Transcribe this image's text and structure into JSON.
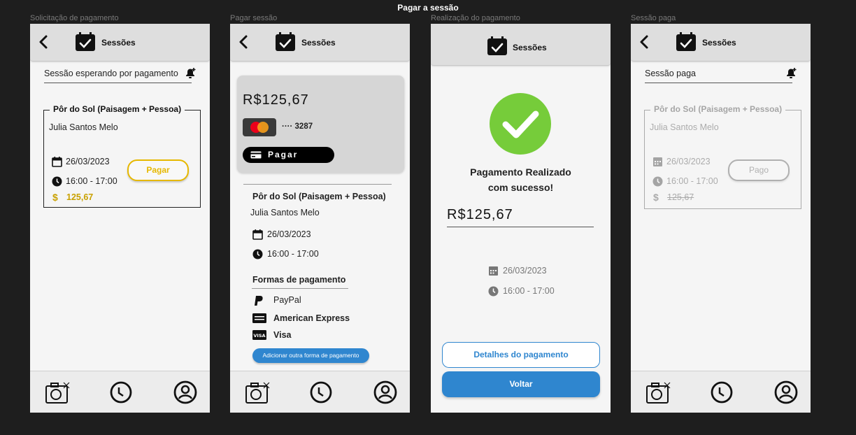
{
  "canvas_title": "Pagar a sessão",
  "frames": [
    {
      "label": "Solicitação de pagamento"
    },
    {
      "label": "Pagar sessão"
    },
    {
      "label": "Realização do pagamento"
    },
    {
      "label": "Sessão paga"
    }
  ],
  "topbar_title": "Sessões",
  "screen1": {
    "heading": "Sessão esperando por pagamento",
    "session_title": "Pôr do Sol (Paisagem + Pessoa)",
    "client": "Julia Santos Melo",
    "date": "26/03/2023",
    "time": "16:00 - 17:00",
    "currency_symbol": "$",
    "price": "125,67",
    "pay_button": "Pagar",
    "accent": "#e6b800"
  },
  "screen2": {
    "amount": "R$125,67",
    "card_dots": "····",
    "card_last4": "3287",
    "pay_button": "Pagar",
    "session_title": "Pôr do Sol (Paisagem + Pessoa)",
    "client": "Julia Santos Melo",
    "date": "26/03/2023",
    "time": "16:00 - 17:00",
    "methods_heading": "Formas de pagamento",
    "methods": [
      {
        "icon": "paypal-icon",
        "label": "PayPal"
      },
      {
        "icon": "amex-icon",
        "label": "American Express"
      },
      {
        "icon": "visa-icon",
        "label": "Visa"
      }
    ],
    "add_method_button": "Adicionar outra forma de pagamento"
  },
  "screen3": {
    "success_line1": "Pagamento Realizado",
    "success_line2": "com sucesso!",
    "amount": "R$125,67",
    "date": "26/03/2023",
    "time": "16:00 - 17:00",
    "details_button": "Detalhes do pagamento",
    "back_button": "Voltar",
    "success_color": "#76cc3a",
    "primary_color": "#2f86cf"
  },
  "screen4": {
    "heading": "Sessão paga",
    "session_title": "Pôr do Sol (Paisagem + Pessoa)",
    "client": "Julia Santos Melo",
    "date": "26/03/2023",
    "time": "16:00 - 17:00",
    "currency_symbol": "$",
    "price": "125,67",
    "status_button": "Pago"
  }
}
